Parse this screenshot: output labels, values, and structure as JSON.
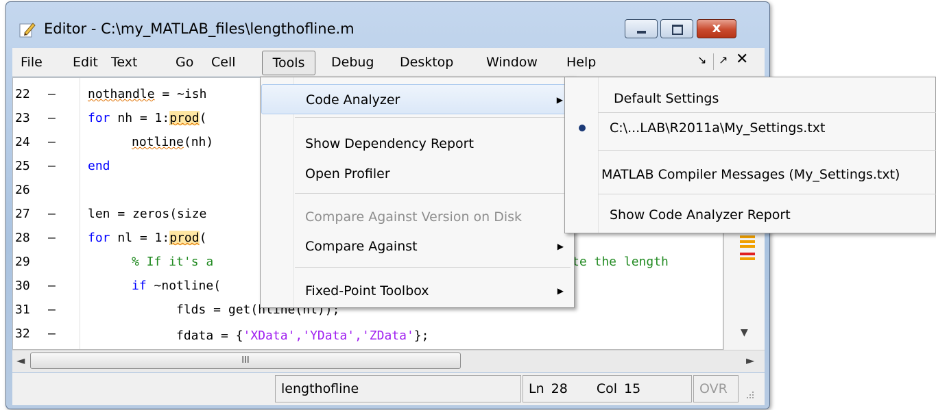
{
  "window": {
    "title": "Editor - C:\\my_MATLAB_files\\lengthofline.m",
    "close_glyph": "x"
  },
  "menubar": {
    "items": [
      "File",
      "Edit",
      "Text",
      "Go",
      "Cell",
      "Tools",
      "Debug",
      "Desktop",
      "Window",
      "Help"
    ],
    "dock_glyph": "↘",
    "undock_glyph": "↗",
    "close_glyph": "✕"
  },
  "editor": {
    "lines": [
      {
        "num": "22",
        "dash": "—"
      },
      {
        "num": "23",
        "dash": "—"
      },
      {
        "num": "24",
        "dash": "—"
      },
      {
        "num": "25",
        "dash": "—"
      },
      {
        "num": "26",
        "dash": ""
      },
      {
        "num": "27",
        "dash": "—"
      },
      {
        "num": "28",
        "dash": "—"
      },
      {
        "num": "29",
        "dash": ""
      },
      {
        "num": "30",
        "dash": "—"
      },
      {
        "num": "31",
        "dash": "—"
      },
      {
        "num": "32",
        "dash": "—"
      }
    ],
    "code": {
      "l22_a": "nothandle",
      "l22_b": " = ~ish",
      "l23_kw": "for",
      "l23_a": " nh = 1:",
      "l23_prod": "prod",
      "l23_b": "(",
      "l24_a": "notline",
      "l24_b": "(nh)",
      "l25_kw": "end",
      "l27": "len = zeros(size",
      "l28_kw": "for",
      "l28_a": " nl = 1:",
      "l28_prod": "prod",
      "l28_b": "(",
      "l29_a": "% If it's a",
      "l29_b": "te the length",
      "l30_kw": "if",
      "l30_a": " ~notline(",
      "l31": "flds = get(hline(nl));",
      "l32_a": "fdata = {",
      "l32_s": "'XData','YData','ZData'",
      "l32_b": "};"
    },
    "hscroll_grip": "III",
    "scroll_left": "◄",
    "scroll_right": "►",
    "scroll_down": "▼"
  },
  "statusbar": {
    "file": "lengthofline",
    "ln_label": "Ln",
    "ln_value": "28",
    "col_label": "Col",
    "col_value": "15",
    "ovr": "OVR"
  },
  "tools_menu": {
    "items": [
      {
        "label": "Code Analyzer",
        "submenu": true,
        "disabled": false
      },
      {
        "label": "Show Dependency Report",
        "submenu": false,
        "disabled": false
      },
      {
        "label": "Open Profiler",
        "submenu": false,
        "disabled": false
      },
      {
        "label": "Compare Against Version on Disk",
        "submenu": false,
        "disabled": true
      },
      {
        "label": "Compare Against",
        "submenu": true,
        "disabled": false
      },
      {
        "label": "Fixed-Point Toolbox",
        "submenu": true,
        "disabled": false
      }
    ],
    "arrow_glyph": "▶"
  },
  "code_analyzer_submenu": {
    "items": [
      {
        "label": "Default Settings",
        "selected": false
      },
      {
        "label": "C:\\...LAB\\R2011a\\My_Settings.txt",
        "selected": true
      },
      {
        "label": "MATLAB Compiler Messages (My_Settings.txt)",
        "selected": false
      },
      {
        "label": "Show Code Analyzer Report",
        "selected": false
      }
    ]
  },
  "colors": {
    "keyword": "#0000ff",
    "comment": "#228b22",
    "string": "#a020f0",
    "highlight": "#ffe7a3",
    "marker_orange": "#f0a000",
    "marker_red": "#e02020"
  }
}
